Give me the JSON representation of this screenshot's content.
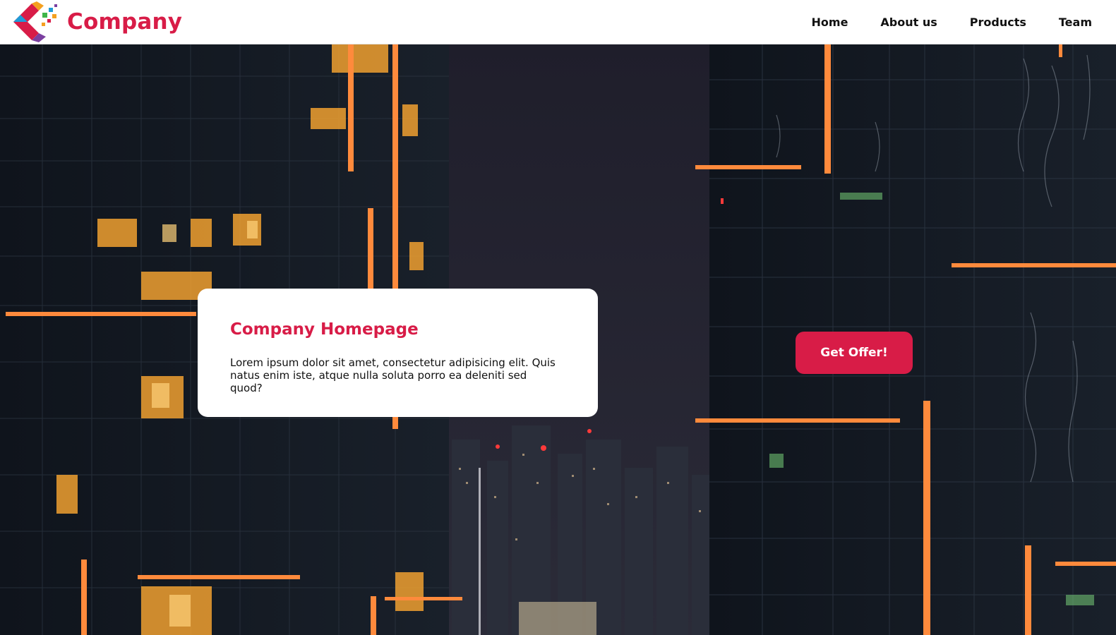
{
  "brand": {
    "name": "Company",
    "logo_icon": "colorful-c-logo-icon"
  },
  "nav": {
    "items": [
      {
        "label": "Home"
      },
      {
        "label": "About us"
      },
      {
        "label": "Products"
      },
      {
        "label": "Team"
      }
    ]
  },
  "hero": {
    "background_icon": "night-city-skyscrapers-photo",
    "card": {
      "title": "Company Homepage",
      "text": "Lorem ipsum dolor sit amet, consectetur adipisicing elit. Quis natus enim iste, atque nulla soluta porro ea deleniti sed quod?"
    },
    "cta_label": "Get Offer!"
  },
  "colors": {
    "accent": "#d81c47",
    "navbar_bg": "#ffffff",
    "hero_bg": "#1b1b26"
  }
}
